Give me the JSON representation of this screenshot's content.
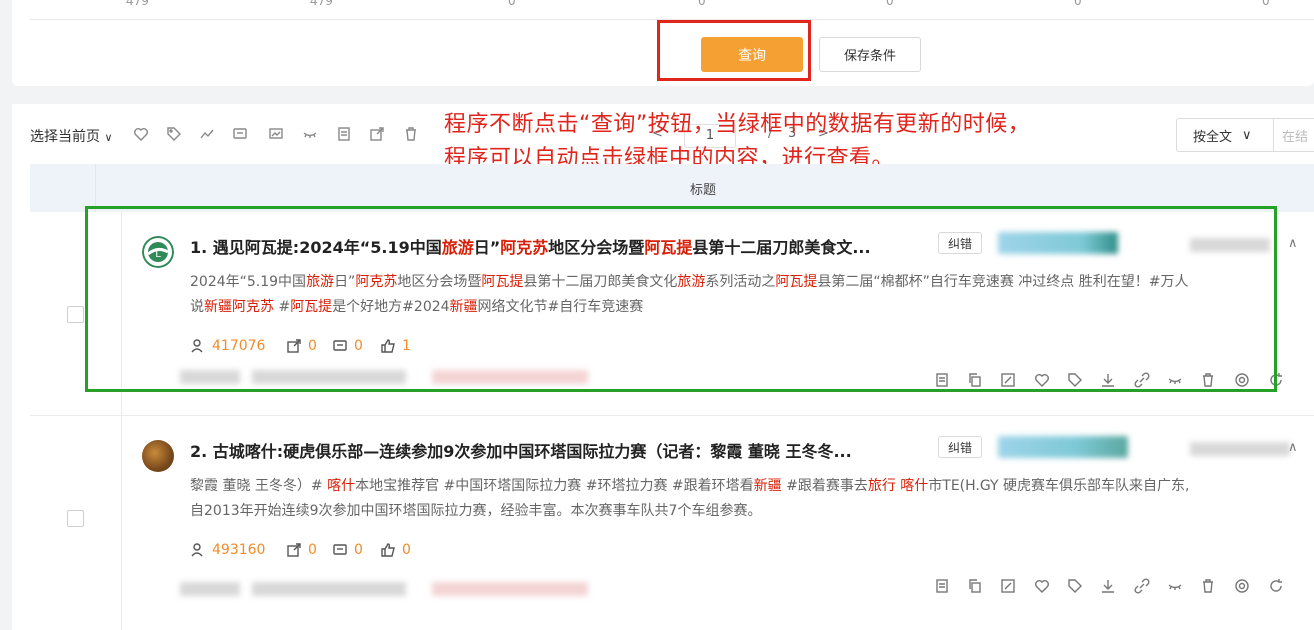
{
  "stats": [
    "479",
    "479",
    "0",
    "0",
    "0",
    "0",
    "0"
  ],
  "filters": {
    "query_label": "查询",
    "save_label": "保存条件"
  },
  "annotation": {
    "line1": "程序不断点击“查询”按钮，当绿框中的数据有更新的时候，",
    "line2": "程序可以自动点击绿框中的内容，进行查看。"
  },
  "toolbar": {
    "select_page_label": "选择当前页",
    "icons": [
      "heart-icon",
      "tag-icon",
      "trend-icon",
      "comment-icon",
      "chart-icon",
      "eye-hide-icon",
      "doc-icon",
      "share-icon",
      "trash-icon"
    ],
    "pager": {
      "prev": "<",
      "current": "1",
      "sep": "/",
      "total": "3",
      "next": ">"
    },
    "fulltext_label": "按全文",
    "search_placeholder": "在结"
  },
  "table": {
    "header_title": "标题",
    "rows": [
      {
        "index": "1.",
        "title_parts": [
          {
            "t": "遇见阿瓦提:2024年“5.19中国",
            "hl": false
          },
          {
            "t": "旅游",
            "hl": true
          },
          {
            "t": "日”",
            "hl": false
          },
          {
            "t": "阿克苏",
            "hl": true
          },
          {
            "t": "地区分会场暨",
            "hl": false
          },
          {
            "t": "阿瓦提",
            "hl": true
          },
          {
            "t": "县第十二届刀郎美食文...",
            "hl": false
          }
        ],
        "correct_label": "纠错",
        "body_line1_parts": [
          {
            "t": "2024年“5.19中国",
            "hl": false
          },
          {
            "t": "旅游",
            "hl": true
          },
          {
            "t": "日”",
            "hl": false
          },
          {
            "t": "阿克苏",
            "hl": true
          },
          {
            "t": "地区分会场暨",
            "hl": false
          },
          {
            "t": "阿瓦提",
            "hl": true
          },
          {
            "t": "县第十二届刀郎美食文化",
            "hl": false
          },
          {
            "t": "旅游",
            "hl": true
          },
          {
            "t": "系列活动之",
            "hl": false
          },
          {
            "t": "阿瓦提",
            "hl": true
          },
          {
            "t": "县第二届“棉都杯”自行车竞速赛 冲过终点 胜利在望！#万人",
            "hl": false
          }
        ],
        "body_line2_parts": [
          {
            "t": "说",
            "hl": false
          },
          {
            "t": "新疆",
            "hl": true
          },
          {
            "t": "阿克苏",
            "hl": true
          },
          {
            "t": " #",
            "hl": false
          },
          {
            "t": "阿瓦提",
            "hl": true
          },
          {
            "t": "是个好地方#2024",
            "hl": false
          },
          {
            "t": "新疆",
            "hl": true
          },
          {
            "t": "网络文化节#自行车竞速赛",
            "hl": false
          }
        ],
        "views": "417076",
        "shares": "0",
        "comments": "0",
        "likes": "1"
      },
      {
        "index": "2.",
        "title_parts": [
          {
            "t": "古城喀什:硬虎俱乐部—连续参加9次参加中国环塔国际拉力赛（记者：黎霞 董晓 王冬冬...",
            "hl": false
          }
        ],
        "correct_label": "纠错",
        "body_line1_parts": [
          {
            "t": "黎霞 董晓 王冬冬）# ",
            "hl": false
          },
          {
            "t": "喀什",
            "hl": true
          },
          {
            "t": "本地宝推荐官 #中国环塔国际拉力赛 #环塔拉力赛 #跟着环塔看",
            "hl": false
          },
          {
            "t": "新疆",
            "hl": true
          },
          {
            "t": " #跟着赛事去",
            "hl": false
          },
          {
            "t": "旅行",
            "hl": true
          },
          {
            "t": " ",
            "hl": false
          },
          {
            "t": "喀什",
            "hl": true
          },
          {
            "t": "市TE(H.GY 硬虎赛车俱乐部车队来自广东,",
            "hl": false
          }
        ],
        "body_line2_parts": [
          {
            "t": "自2013年开始连续9次参加中国环塔国际拉力赛，经验丰富。本次赛事车队共7个车组参赛。",
            "hl": false
          }
        ],
        "views": "493160",
        "shares": "0",
        "comments": "0",
        "likes": "0"
      }
    ]
  },
  "row_action_icons": [
    "doc-icon",
    "copy-icon",
    "edit-icon",
    "heart-icon",
    "tag-icon",
    "download-icon",
    "link-icon",
    "eye-hide-icon",
    "trash-icon",
    "at-icon",
    "refresh-icon"
  ],
  "colors": {
    "query_button": "#f5a032",
    "highlight": "#d81e06",
    "metric_value": "#f08c2b",
    "annotation": "#e0251d",
    "red_frame": "#e0251d",
    "green_frame": "#26a026",
    "table_header_bg": "#eef2f9"
  }
}
